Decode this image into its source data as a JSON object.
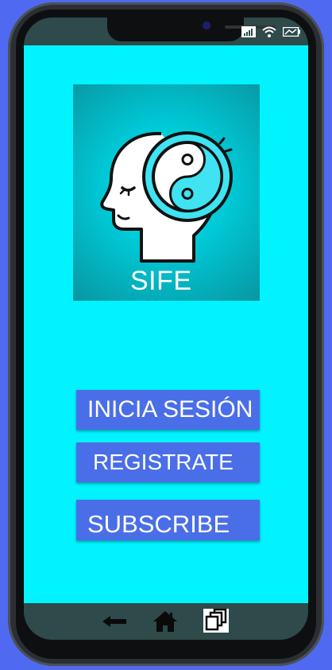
{
  "app": {
    "logo_text": "SIFE"
  },
  "buttons": {
    "login_label": "INICIA SESIÓN",
    "register_label": "REGISTRATE",
    "subscribe_label": "SUBSCRIBE"
  },
  "icons": {
    "signal": "signal-icon",
    "wifi": "wifi-icon",
    "battery": "battery-icon",
    "back": "back-arrow-icon",
    "home": "home-icon",
    "recents": "recents-icon"
  },
  "colors": {
    "background": "#00f3ff",
    "button": "#4a6ee8",
    "frame": "#4f6af0"
  }
}
